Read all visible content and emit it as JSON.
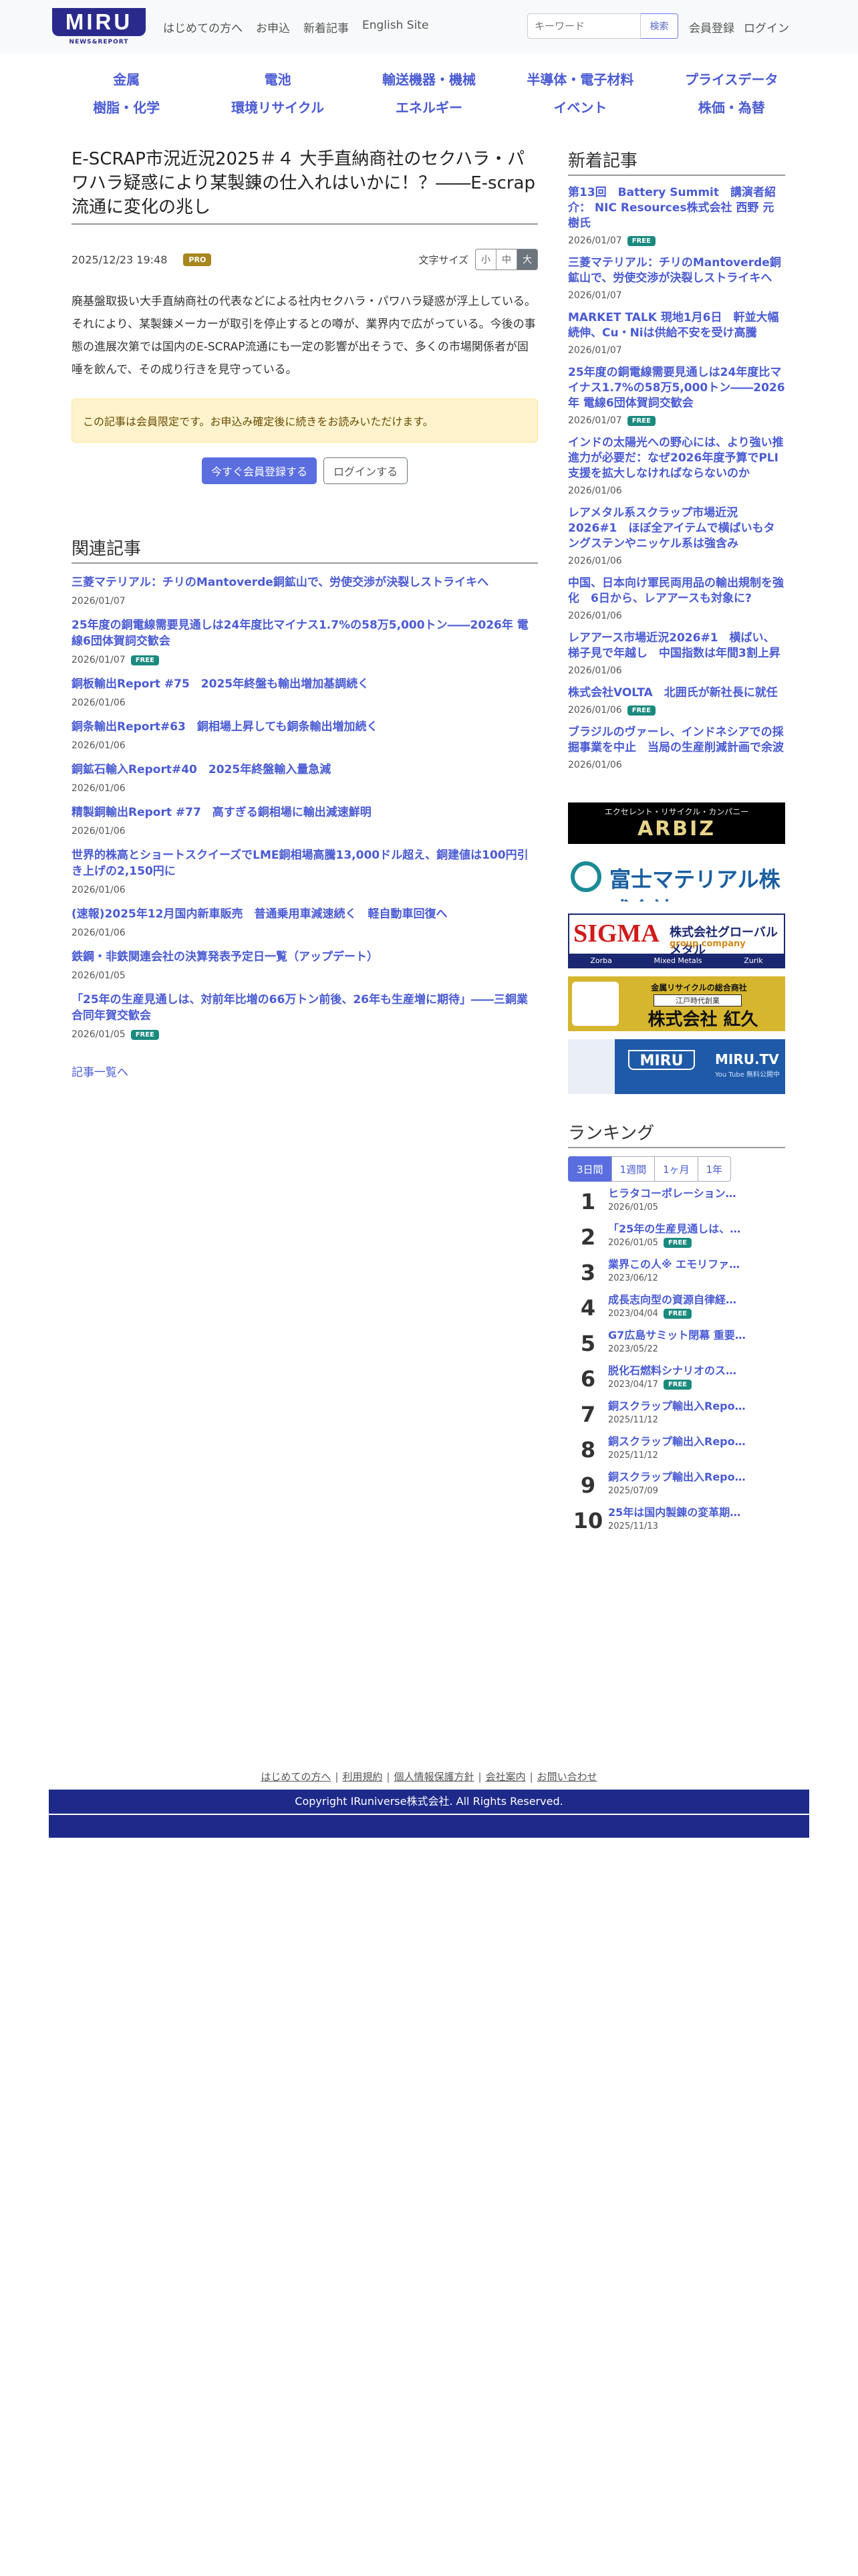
{
  "header": {
    "logo_text": "MIRU",
    "logo_sub": "NEWS&REPORT",
    "nav": [
      "はじめての方へ",
      "お申込",
      "新着記事",
      "English Site"
    ],
    "search_placeholder": "キーワード",
    "search_button": "検索",
    "register": "会員登録",
    "login": "ログイン"
  },
  "categories": {
    "row1": [
      "金属",
      "電池",
      "輸送機器・機械",
      "半導体・電子材料",
      "プライスデータ"
    ],
    "row2": [
      "樹脂・化学",
      "環境リサイクル",
      "エネルギー",
      "イベント",
      "株価・為替"
    ]
  },
  "article": {
    "title": "E-SCRAP市況近況2025＃４ 大手直納商社のセクハラ・パワハラ疑惑により某製錬の仕入れはいかに！？――E-scrap流通に変化の兆し",
    "date": "2025/12/23 19:48",
    "badge": "PRO",
    "font_size_label": "文字サイズ",
    "font_sizes": [
      "小",
      "中",
      "大"
    ],
    "body": "廃基盤取扱い大手直納商社の代表などによる社内セクハラ・パワハラ疑惑が浮上している。それにより、某製錬メーカーが取引を停止するとの噂が、業界内で広がっている。今後の事態の進展次第では国内のE-SCRAP流通にも一定の影響が出そうで、多くの市場関係者が固唾を飲んで、その成り行きを見守っている。",
    "notice": "この記事は会員限定です。お申込み確定後に続きをお読みいただけます。",
    "cta_register": "今すぐ会員登録する",
    "cta_login": "ログインする"
  },
  "related": {
    "heading": "関連記事",
    "items": [
      {
        "title": "三菱マテリアル：チリのMantoverde銅鉱山で、労使交渉が決裂しストライキへ",
        "date": "2026/01/07",
        "free": ""
      },
      {
        "title": "25年度の銅電線需要見通しは24年度比マイナス1.7%の58万5,000トン――2026年 電線6団体賀詞交歓会",
        "date": "2026/01/07",
        "free": "FREE"
      },
      {
        "title": "銅板輸出Report #75　2025年終盤も輸出増加基調続く",
        "date": "2026/01/06",
        "free": ""
      },
      {
        "title": "銅条輸出Report#63　銅相場上昇しても銅条輸出増加続く",
        "date": "2026/01/06",
        "free": ""
      },
      {
        "title": "銅鉱石輸入Report#40　2025年終盤輸入量急減",
        "date": "2026/01/06",
        "free": ""
      },
      {
        "title": "精製銅輸出Report #77　高すぎる銅相場に輸出減速鮮明",
        "date": "2026/01/06",
        "free": ""
      },
      {
        "title": "世界的株高とショートスクイーズでLME銅相場高騰13,000ドル超え、銅建値は100円引き上げの2,150円に",
        "date": "2026/01/06",
        "free": ""
      },
      {
        "title": "(速報)2025年12月国内新車販売　普通乗用車減速続く　軽自動車回復へ",
        "date": "2026/01/06",
        "free": ""
      },
      {
        "title": "鉄鋼・非鉄関連会社の決算発表予定日一覧（アップデート）",
        "date": "2026/01/05",
        "free": ""
      },
      {
        "title": "「25年の生産見通しは、対前年比増の66万トン前後、26年も生産増に期待」――三銅業合同年賀交歓会",
        "date": "2026/01/05",
        "free": "FREE"
      }
    ],
    "more": "記事一覧へ"
  },
  "latest": {
    "heading": "新着記事",
    "items": [
      {
        "title": "第13回　Battery Summit　講演者紹介： NIC Resources株式会社 西野 元樹氏",
        "date": "2026/01/07",
        "free": "FREE"
      },
      {
        "title": "三菱マテリアル：チリのMantoverde銅鉱山で、労使交渉が決裂しストライキへ",
        "date": "2026/01/07",
        "free": ""
      },
      {
        "title": "MARKET TALK 現地1月6日　軒並大幅続伸、Cu・Niは供給不安を受け高騰",
        "date": "2026/01/07",
        "free": ""
      },
      {
        "title": "25年度の銅電線需要見通しは24年度比マイナス1.7%の58万5,000トン――2026年 電線6団体賀詞交歓会",
        "date": "2026/01/07",
        "free": "FREE"
      },
      {
        "title": "インドの太陽光への野心には、より強い推進力が必要だ：なぜ2026年度予算でPLI支援を拡大しなければならないのか",
        "date": "2026/01/06",
        "free": ""
      },
      {
        "title": "レアメタル系スクラップ市場近況2026#1　ほぼ全アイテムで横ばいもタングステンやニッケル系は強含み",
        "date": "2026/01/06",
        "free": ""
      },
      {
        "title": "中国、日本向け軍民両用品の輸出規制を強化　6日から、レアアースも対象に?",
        "date": "2026/01/06",
        "free": ""
      },
      {
        "title": "レアアース市場近況2026#1　横ばい、梯子見で年越し　中国指数は年間3割上昇",
        "date": "2026/01/06",
        "free": ""
      },
      {
        "title": "株式会社VOLTA　北囲氏が新社長に就任",
        "date": "2026/01/06",
        "free": "FREE"
      },
      {
        "title": "ブラジルのヴァーレ、インドネシアでの採掘事業を中止　当局の生産削減計画で余波",
        "date": "2026/01/06",
        "free": ""
      }
    ]
  },
  "banners": {
    "arbiz_sub": "エクセレント・リサイクル・カンパニー",
    "arbiz_main": "ARBIZ",
    "fuji": "富士マテリアル株式会社",
    "sigma_logo": "SIGMA",
    "sigma_name": "株式会社グローバルメタル",
    "sigma_group": "group company",
    "sigma_items": [
      "Zorba",
      "Mixed Metals",
      "Zurik"
    ],
    "kohisa_top": "金属リサイクルの総合商社",
    "kohisa_mid": "江戸時代創業",
    "kohisa_name": "株式会社 紅久",
    "mirutv_logo": "MIRU",
    "mirutv_name": "MIRU.TV",
    "mirutv_sub": "You Tube 無料公開中"
  },
  "ranking": {
    "heading": "ランキング",
    "tabs": [
      "3日間",
      "1週間",
      "1ヶ月",
      "1年"
    ],
    "items": [
      {
        "rank": "1",
        "title": "ヒラタコーポレーション…",
        "date": "2026/01/05",
        "free": ""
      },
      {
        "rank": "2",
        "title": "「25年の生産見通しは、…",
        "date": "2026/01/05",
        "free": "FREE"
      },
      {
        "rank": "3",
        "title": "業界この人※ エモリファ…",
        "date": "2023/06/12",
        "free": ""
      },
      {
        "rank": "4",
        "title": "成長志向型の資源自律経…",
        "date": "2023/04/04",
        "free": "FREE"
      },
      {
        "rank": "5",
        "title": "G7広島サミット閉幕 重要…",
        "date": "2023/05/22",
        "free": ""
      },
      {
        "rank": "6",
        "title": "脱化石燃料シナリオのス…",
        "date": "2023/04/17",
        "free": "FREE"
      },
      {
        "rank": "7",
        "title": "銅スクラップ輸出入Repo…",
        "date": "2025/11/12",
        "free": ""
      },
      {
        "rank": "8",
        "title": "銅スクラップ輸出入Repo…",
        "date": "2025/11/12",
        "free": ""
      },
      {
        "rank": "9",
        "title": "銅スクラップ輸出入Repo…",
        "date": "2025/07/09",
        "free": ""
      },
      {
        "rank": "10",
        "title": "25年は国内製錬の変革期…",
        "date": "2025/11/13",
        "free": ""
      }
    ]
  },
  "footer": {
    "links": [
      "はじめての方へ",
      "利用規約",
      "個人情報保護方針",
      "会社案内",
      "お問い合わせ"
    ],
    "separator": "|",
    "copyright": "Copyright IRuniverse株式会社. All Rights Reserved."
  }
}
